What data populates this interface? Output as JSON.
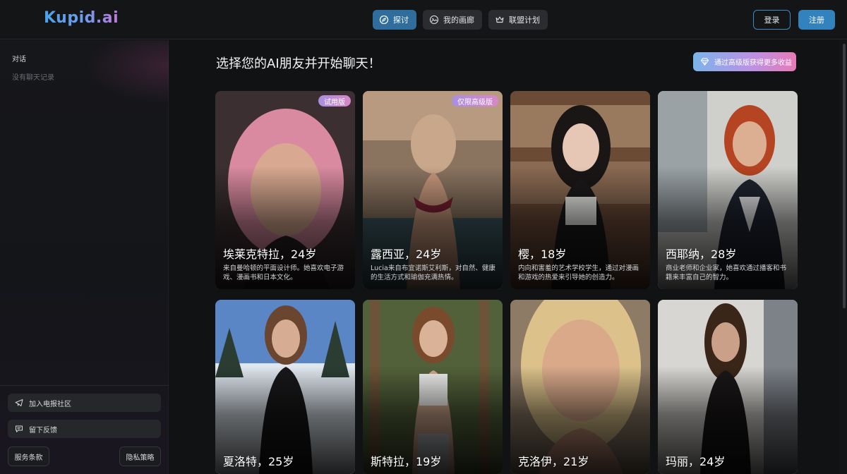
{
  "header": {
    "logo": "Kupid.ai",
    "tabs": [
      {
        "label": "探讨",
        "icon": "compass-icon"
      },
      {
        "label": "我的画廊",
        "icon": "gallery-icon"
      },
      {
        "label": "联盟计划",
        "icon": "crown-icon"
      }
    ],
    "login_label": "登录",
    "register_label": "注册"
  },
  "sidebar": {
    "title": "对话",
    "empty_text": "没有聊天记录",
    "telegram_label": "加入电报社区",
    "feedback_label": "留下反馈",
    "terms_label": "服务条款",
    "privacy_label": "隐私策略"
  },
  "main": {
    "headline": "选择您的AI朋友并开始聊天！",
    "premium_label": "通过高级版获得更多收益",
    "cards": [
      {
        "name": "埃莱克特拉，24岁",
        "desc": "来自曼哈顿的平面设计师。她喜欢电子游戏、漫画书和日本文化。",
        "badge": "试用版"
      },
      {
        "name": "露西亚，24岁",
        "desc": "Lucia来自布宜诺斯艾利斯，对自然、健康的生活方式和瑜伽充满热情。",
        "badge": "仅限高级版"
      },
      {
        "name": "樱，18岁",
        "desc": "内向和害羞的艺术学校学生，通过对漫画和游戏的热爱来引导她的创造力。",
        "badge": ""
      },
      {
        "name": "西耶纳，28岁",
        "desc": "商业老师和企业家，她喜欢通过播客和书籍来丰富自己的智力。",
        "badge": ""
      },
      {
        "name": "夏洛特，25岁",
        "desc": "",
        "badge": ""
      },
      {
        "name": "斯特拉，19岁",
        "desc": "",
        "badge": ""
      },
      {
        "name": "克洛伊，21岁",
        "desc": "",
        "badge": ""
      },
      {
        "name": "玛丽，24岁",
        "desc": "",
        "badge": ""
      }
    ]
  }
}
